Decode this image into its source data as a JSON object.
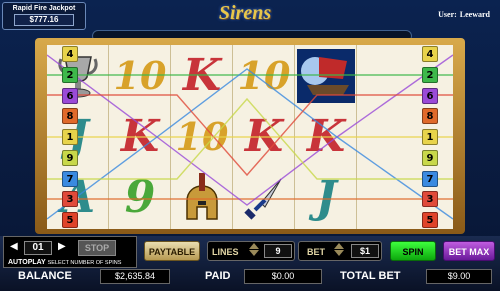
{
  "jackpot": {
    "label": "Rapid Fire Jackpot",
    "amount": "$777.16"
  },
  "logo": "Sirens",
  "user": {
    "label": "User:",
    "name": "Leeward"
  },
  "reels": [
    [
      "trophy",
      "J",
      "A"
    ],
    [
      "10",
      "K",
      "9"
    ],
    [
      "K",
      "10",
      "helmet"
    ],
    [
      "10",
      "K",
      "dagger"
    ],
    [
      "ship",
      "K",
      "J"
    ]
  ],
  "paylines": {
    "left": [
      "4",
      "2",
      "6",
      "8",
      "1",
      "9",
      "7",
      "3",
      "5"
    ],
    "right": [
      "4",
      "2",
      "6",
      "8",
      "1",
      "9",
      "7",
      "3",
      "5"
    ]
  },
  "controls": {
    "autoplay_count": "01",
    "stop": "STOP",
    "autoplay_label": "AUTOPLAY",
    "autoplay_sub": "SELECT NUMBER OF SPINS",
    "paytable": "PAYTABLE",
    "lines_label": "LINES",
    "lines_value": "9",
    "bet_label": "BET",
    "bet_value": "$1",
    "spin": "SPIN",
    "bet_max": "BET MAX"
  },
  "stats": {
    "balance_label": "BALANCE",
    "balance_value": "$2,635.84",
    "paid_label": "PAID",
    "paid_value": "$0.00",
    "total_bet_label": "TOTAL BET",
    "total_bet_value": "$9.00"
  },
  "colors": {
    "line_1": "#e8d34a",
    "line_2": "#3db84a",
    "line_3": "#e04a3a",
    "line_4": "#e8d34a",
    "line_5": "#e0442a",
    "line_6": "#9a4ad8",
    "line_7": "#3a8ae0",
    "line_8": "#e06a2a",
    "line_9": "#c8d84a"
  }
}
